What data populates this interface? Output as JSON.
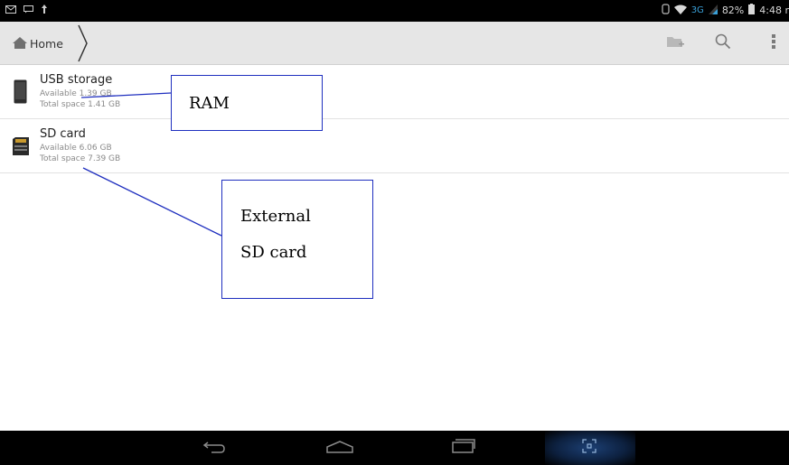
{
  "status_bar": {
    "network_type": "3G",
    "battery_level": "82%",
    "time": "4:48 r"
  },
  "action_bar": {
    "breadcrumb_label": "Home"
  },
  "storage_items": [
    {
      "name": "USB storage",
      "available": "Available 1.39 GB",
      "total": "Total space 1.41 GB"
    },
    {
      "name": "SD card",
      "available": "Available 6.06 GB",
      "total": "Total space 7.39 GB"
    }
  ],
  "annotations": {
    "ram_label": "RAM",
    "sd_label_line1": "External",
    "sd_label_line2": "SD card"
  },
  "colors": {
    "callout_border": "#1f2fbf",
    "network_3g": "#3aa0d8"
  }
}
